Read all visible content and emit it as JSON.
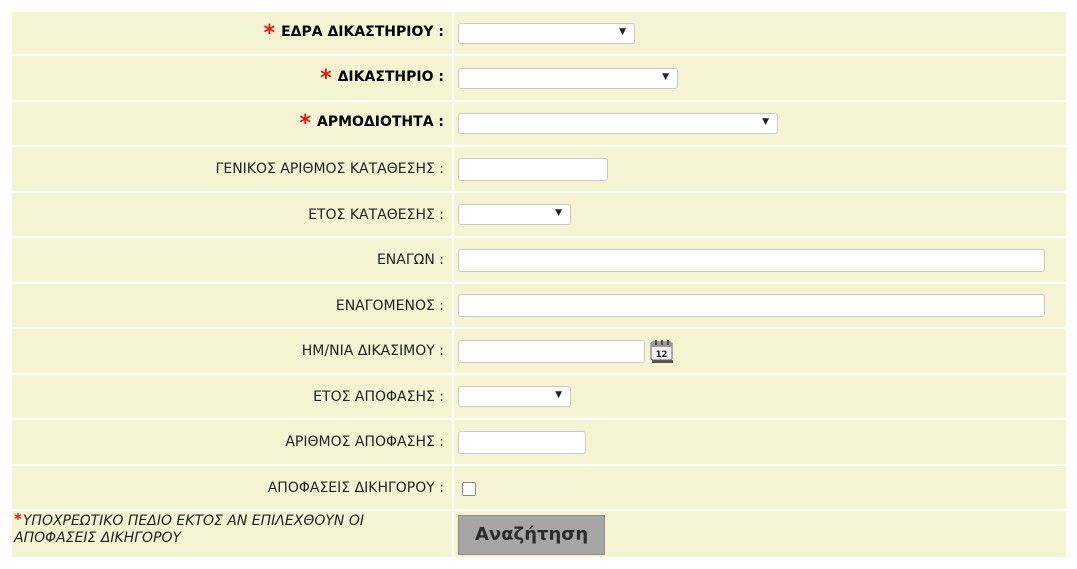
{
  "form": {
    "fields": [
      {
        "label": "ΕΔΡΑ ΔΙΚΑΣΤΗΡΙΟΥ :",
        "required": true
      },
      {
        "label": "ΔΙΚΑΣΤΗΡΙΟ :",
        "required": true
      },
      {
        "label": "ΑΡΜΟΔΙΟΤΗΤΑ :",
        "required": true
      },
      {
        "label": "ΓΕΝΙΚΟΣ ΑΡΙΘΜΟΣ ΚΑΤΑΘΕΣΗΣ :",
        "required": false
      },
      {
        "label": "ΕΤΟΣ ΚΑΤΑΘΕΣΗΣ :",
        "required": false
      },
      {
        "label": "ΕΝΑΓΩΝ :",
        "required": false
      },
      {
        "label": "ΕΝΑΓΟΜΕΝΟΣ :",
        "required": false
      },
      {
        "label": "ΗΜ/ΝΙΑ ΔΙΚΑΣΙΜΟΥ :",
        "required": false
      },
      {
        "label": "ΕΤΟΣ ΑΠΟΦΑΣΗΣ :",
        "required": false
      },
      {
        "label": "ΑΡΙΘΜΟΣ ΑΠΟΦΑΣΗΣ :",
        "required": false
      },
      {
        "label": "ΑΠΟΦΑΣΕΙΣ ΔΙΚΗΓΟΡΟΥ :",
        "required": false
      }
    ],
    "required_star": "*",
    "required_note": "ΥΠΟΧΡΕΩΤΙΚΟ ΠΕΔΙΟ ΕΚΤΟΣ ΑΝ ΕΠΙΛΕΧΘΟΥΝ ΟΙ ΑΠΟΦΑΣΕΙΣ ΔΙΚΗΓΟΡΟΥ",
    "search_button": "Αναζήτηση",
    "calendar_day": "12",
    "lawyer_decisions_checked": false
  },
  "colors": {
    "row_background": "#f4f4d3",
    "required_star": "#e8150a",
    "button_background": "#a6a6a6"
  }
}
